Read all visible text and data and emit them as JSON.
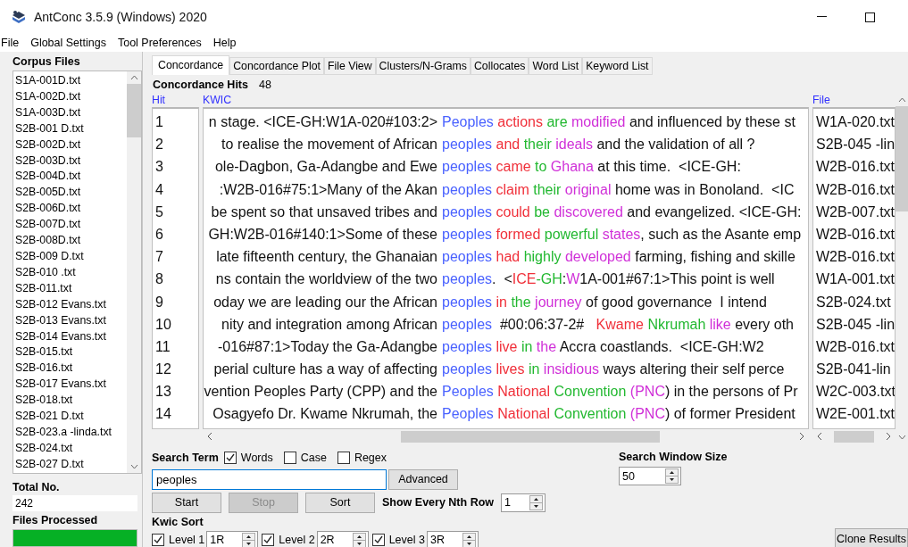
{
  "window": {
    "title": "AntConc 3.5.9 (Windows) 2020"
  },
  "menu": [
    "File",
    "Global Settings",
    "Tool Preferences",
    "Help"
  ],
  "corpus_files": {
    "title": "Corpus Files",
    "items": [
      "S1A-001D.txt",
      "S1A-002D.txt",
      "S1A-003D.txt",
      "S2B-001 D.txt",
      "S2B-002D.txt",
      "S2B-003D.txt",
      "S2B-004D.txt",
      "S2B-005D.txt",
      "S2B-006D.txt",
      "S2B-007D.txt",
      "S2B-008D.txt",
      "S2B-009 D.txt",
      "S2B-010 .txt",
      "S2B-011.txt",
      "S2B-012 Evans.txt",
      "S2B-013 Evans.txt",
      "S2B-014 Evans.txt",
      "S2B-015.txt",
      "S2B-016.txt",
      "S2B-017 Evans.txt",
      "S2B-018.txt",
      "S2B-021 D.txt",
      "S2B-023.a -linda.txt",
      "S2B-024.txt",
      "S2B-027 D.txt"
    ]
  },
  "total_no": {
    "label": "Total No.",
    "value": "242"
  },
  "files_processed": {
    "label": "Files Processed",
    "level": 1
  },
  "tabs": [
    {
      "label": "Concordance",
      "selected": true
    },
    {
      "label": "Concordance Plot",
      "selected": false
    },
    {
      "label": "File View",
      "selected": false
    },
    {
      "label": "Clusters/N-Grams",
      "selected": false
    },
    {
      "label": "Collocates",
      "selected": false
    },
    {
      "label": "Word List",
      "selected": false
    },
    {
      "label": "Keyword List",
      "selected": false
    }
  ],
  "hits": {
    "label": "Concordance Hits",
    "value": "48"
  },
  "table": {
    "columns": [
      "Hit",
      "KWIC",
      "File"
    ],
    "rows": [
      {
        "hit": "1",
        "left": "n stage. <ICE-GH:W1A-020#103:2>",
        "key": "Peoples",
        "right": [
          {
            "text": " actions",
            "color": "#f0303a"
          },
          {
            "text": " are",
            "color": "#22b830"
          },
          {
            "text": " modified",
            "color": "#d030d8"
          },
          {
            "text": " and influenced by these st"
          }
        ],
        "file": "W1A-020.txt"
      },
      {
        "hit": "2",
        "left": "to realise the movement of African",
        "key": "peoples",
        "right": [
          {
            "text": " and",
            "color": "#f0303a"
          },
          {
            "text": " their",
            "color": "#22b830"
          },
          {
            "text": " ideals",
            "color": "#d030d8"
          },
          {
            "text": " and the validation of all ?"
          }
        ],
        "file": "S2B-045 -lin"
      },
      {
        "hit": "3",
        "left": "ole-Dagbon, Ga-Adangbe and Ewe",
        "key": "peoples",
        "right": [
          {
            "text": " came",
            "color": "#f0303a"
          },
          {
            "text": " to",
            "color": "#22b830"
          },
          {
            "text": " Ghana",
            "color": "#d030d8"
          },
          {
            "text": " at this time.  <ICE-GH:"
          }
        ],
        "file": "W2B-016.txt"
      },
      {
        "hit": "4",
        "left": ":W2B-016#75:1>Many of the Akan",
        "key": "peoples",
        "right": [
          {
            "text": " claim",
            "color": "#f0303a"
          },
          {
            "text": " their",
            "color": "#22b830"
          },
          {
            "text": " original",
            "color": "#d030d8"
          },
          {
            "text": " home was in Bonoland.  <IC"
          }
        ],
        "file": "W2B-016.txt"
      },
      {
        "hit": "5",
        "left": "be spent so that unsaved tribes and",
        "key": "peoples",
        "right": [
          {
            "text": " could",
            "color": "#f0303a"
          },
          {
            "text": " be",
            "color": "#22b830"
          },
          {
            "text": " discovered",
            "color": "#d030d8"
          },
          {
            "text": " and evangelized. <ICE-GH:"
          }
        ],
        "file": "W2B-007.txt"
      },
      {
        "hit": "6",
        "left": "GH:W2B-016#140:1>Some of these",
        "key": "peoples",
        "right": [
          {
            "text": " formed",
            "color": "#f0303a"
          },
          {
            "text": " powerful",
            "color": "#22b830"
          },
          {
            "text": " states",
            "color": "#d030d8"
          },
          {
            "text": ", such as the Asante emp"
          }
        ],
        "file": "W2B-016.txt"
      },
      {
        "hit": "7",
        "left": "late fifteenth century, the Ghanaian",
        "key": "peoples",
        "right": [
          {
            "text": " had",
            "color": "#f0303a"
          },
          {
            "text": " highly",
            "color": "#22b830"
          },
          {
            "text": " developed",
            "color": "#d030d8"
          },
          {
            "text": " farming, fishing and skille"
          }
        ],
        "file": "W2B-016.txt"
      },
      {
        "hit": "8",
        "left": "ns contain the worldview of the two",
        "key": "peoples",
        "right": [
          {
            "text": ".  <"
          },
          {
            "text": "ICE",
            "color": "#f0303a"
          },
          {
            "text": "-GH",
            "color": "#22b830"
          },
          {
            "text": ":"
          },
          {
            "text": "W",
            "color": "#d030d8"
          },
          {
            "text": "1A-001#67:1>This point is well"
          }
        ],
        "file": "W1A-001.txt"
      },
      {
        "hit": "9",
        "left": "oday we are leading our the African",
        "key": "peoples",
        "right": [
          {
            "text": " in",
            "color": "#f0303a"
          },
          {
            "text": " the",
            "color": "#22b830"
          },
          {
            "text": " journey",
            "color": "#d030d8"
          },
          {
            "text": " of good governance  I intend"
          }
        ],
        "file": "S2B-024.txt"
      },
      {
        "hit": "10",
        "left": "nity and integration among African",
        "key": "peoples",
        "right": [
          {
            "text": "  #00:06:37-2#   "
          },
          {
            "text": "Kwame",
            "color": "#f0303a"
          },
          {
            "text": " Nkrumah",
            "color": "#22b830"
          },
          {
            "text": " like",
            "color": "#d030d8"
          },
          {
            "text": " every oth"
          }
        ],
        "file": "S2B-045 -lin"
      },
      {
        "hit": "11",
        "left": "-016#87:1>Today the Ga-Adangbe",
        "key": "peoples",
        "right": [
          {
            "text": " live",
            "color": "#f0303a"
          },
          {
            "text": " in",
            "color": "#22b830"
          },
          {
            "text": " the",
            "color": "#d030d8"
          },
          {
            "text": " Accra coastlands.  <ICE-GH:W2"
          }
        ],
        "file": "W2B-016.txt"
      },
      {
        "hit": "12",
        "left": "perial culture has a way of affecting",
        "key": "peoples",
        "right": [
          {
            "text": " lives",
            "color": "#f0303a"
          },
          {
            "text": " in",
            "color": "#22b830"
          },
          {
            "text": " insidious",
            "color": "#d030d8"
          },
          {
            "text": " ways altering their self perce"
          }
        ],
        "file": "S2B-041-lin"
      },
      {
        "hit": "13",
        "left": "vention Peoples Party (CPP) and the",
        "key": "Peoples",
        "right": [
          {
            "text": " National",
            "color": "#f0303a"
          },
          {
            "text": " Convention",
            "color": "#22b830"
          },
          {
            "text": " (PNC",
            "color": "#d030d8"
          },
          {
            "text": ") in the persons of Pr"
          }
        ],
        "file": "W2C-003.txt"
      },
      {
        "hit": "14",
        "left": "Osagyefo Dr. Kwame Nkrumah, the",
        "key": "Peoples",
        "right": [
          {
            "text": " National",
            "color": "#f0303a"
          },
          {
            "text": " Convention",
            "color": "#22b830"
          },
          {
            "text": " (PNC",
            "color": "#d030d8"
          },
          {
            "text": ") of former President"
          }
        ],
        "file": "W2E-001.txt"
      }
    ]
  },
  "search": {
    "label": "Search Term",
    "options": [
      {
        "label": "Words",
        "checked": true
      },
      {
        "label": "Case",
        "checked": false
      },
      {
        "label": "Regex",
        "checked": false
      }
    ],
    "value": "peoples",
    "advanced": "Advanced"
  },
  "buttons": [
    {
      "label": "Start",
      "disabled": false
    },
    {
      "label": "Stop",
      "disabled": true
    },
    {
      "label": "Sort",
      "disabled": false
    }
  ],
  "nth_row": {
    "label": "Show Every Nth Row",
    "value": "1"
  },
  "window_size": {
    "label": "Search Window Size",
    "value": "50"
  },
  "kwic_sort": {
    "label": "Kwic Sort",
    "levels": [
      {
        "label": "Level 1",
        "checked": true,
        "value": "1R"
      },
      {
        "label": "Level 2",
        "checked": true,
        "value": "2R"
      },
      {
        "label": "Level 3",
        "checked": true,
        "value": "3R"
      }
    ]
  },
  "clone": "Clone Results"
}
